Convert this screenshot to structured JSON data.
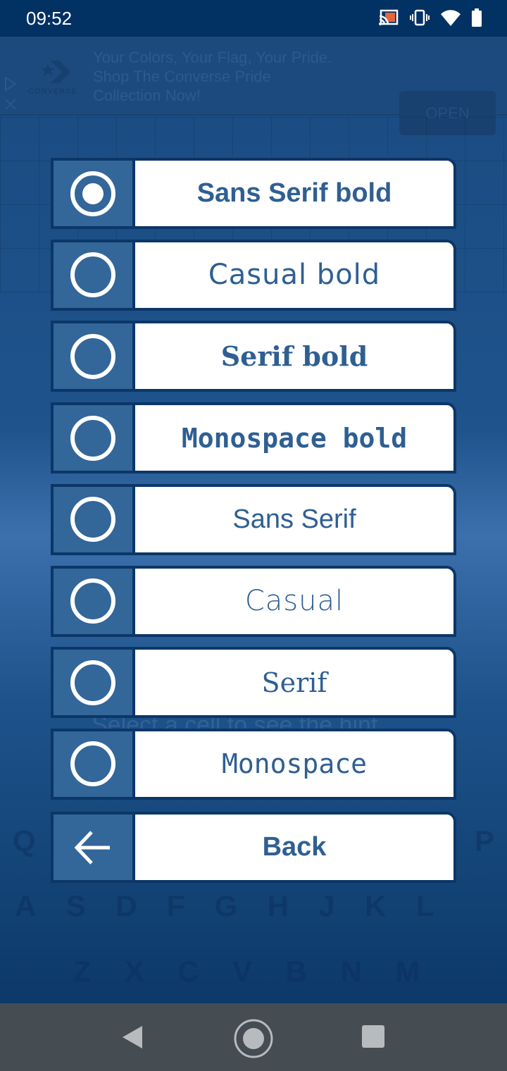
{
  "status_bar": {
    "time": "09:52",
    "icons": [
      "cast-icon",
      "vibrate-icon",
      "wifi-icon",
      "battery-icon"
    ]
  },
  "ad": {
    "brand": "CONVERSE",
    "text_lines": [
      "Your Colors, Your Flag, Your Pride.",
      "Shop The Converse Pride",
      "Collection Now!"
    ],
    "open_label": "OPEN"
  },
  "background": {
    "hint": "Select a cell to see the hint",
    "keyboard_rows": [
      [
        "Q",
        "",
        "",
        "",
        "",
        "",
        "",
        "",
        "",
        "P"
      ],
      [
        "A",
        "S",
        "D",
        "F",
        "G",
        "H",
        "J",
        "K",
        "L"
      ],
      [
        "Z",
        "X",
        "C",
        "V",
        "B",
        "N",
        "M"
      ]
    ]
  },
  "font_options": [
    {
      "label": "Sans Serif bold",
      "selected": true
    },
    {
      "label": "Casual bold",
      "selected": false
    },
    {
      "label": "Serif bold",
      "selected": false
    },
    {
      "label": "Monospace bold",
      "selected": false
    },
    {
      "label": "Sans Serif",
      "selected": false
    },
    {
      "label": "Casual",
      "selected": false
    },
    {
      "label": "Serif",
      "selected": false
    },
    {
      "label": "Monospace",
      "selected": false
    }
  ],
  "back": {
    "label": "Back",
    "icon": "arrow-left-icon"
  },
  "colors": {
    "accent": "#336699",
    "border": "#0b3668",
    "text": "#2f5f92"
  }
}
